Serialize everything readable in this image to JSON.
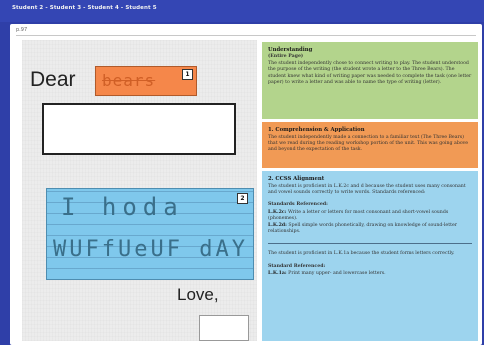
{
  "breadcrumb": "Student 2 - Student 3 - Student 4 - Student 5",
  "page_number": "p.97",
  "worksheet": {
    "greeting": "Dear",
    "recipient_handwriting": "bears",
    "badge_1": "1",
    "badge_2": "2",
    "body_line_1": "I hoda",
    "body_line_2": "WUFfUeUF dAY",
    "closing": "Love,"
  },
  "panels": {
    "understanding": {
      "heading": "Understanding",
      "subheading": "(Entire Page)",
      "text": "The student independently chose to connect writing to play. The student understood the purpose of the writing (the student wrote a letter to the Three Bears). The student knew what kind of writing paper was needed to complete the task (one letter paper) to write a letter and was able to name the type of writing (letter)."
    },
    "comprehension": {
      "heading": "1. Comprehension & Application",
      "text": "The student independently made a connection to a familiar text (The Three Bears) that we read during the reading workshop portion of the unit. This was going above and beyond the expectation of the task."
    },
    "ccss": {
      "heading": "2. CCSS Alignment",
      "text": "The student is proficient in L.K.2c and d because the student uses many consonant and vowel sounds correctly to write words. Standards referenced:",
      "standards_heading": "Standards Referenced:",
      "std_1_code": "L.K.2c:",
      "std_1_text": "Write a letter or letters for most consonant and short-vowel sounds (phonemes).",
      "std_2_code": "L.K.2d:",
      "std_2_text": "Spell simple words phonetically, drawing on knowledge of sound-letter relationships.",
      "proficient_1a": "The student is proficient in L.K.1a because the student forms letters correctly.",
      "standard_heading": "Standard Referenced:",
      "std_3_code": "L.K.1a:",
      "std_3_text": "Print many upper- and lowercase letters."
    }
  },
  "colors": {
    "frame": "#2f3fa8",
    "green_panel": "#b3d48c",
    "orange_panel": "#f19a55",
    "blue_panel": "#9dd4ee"
  }
}
